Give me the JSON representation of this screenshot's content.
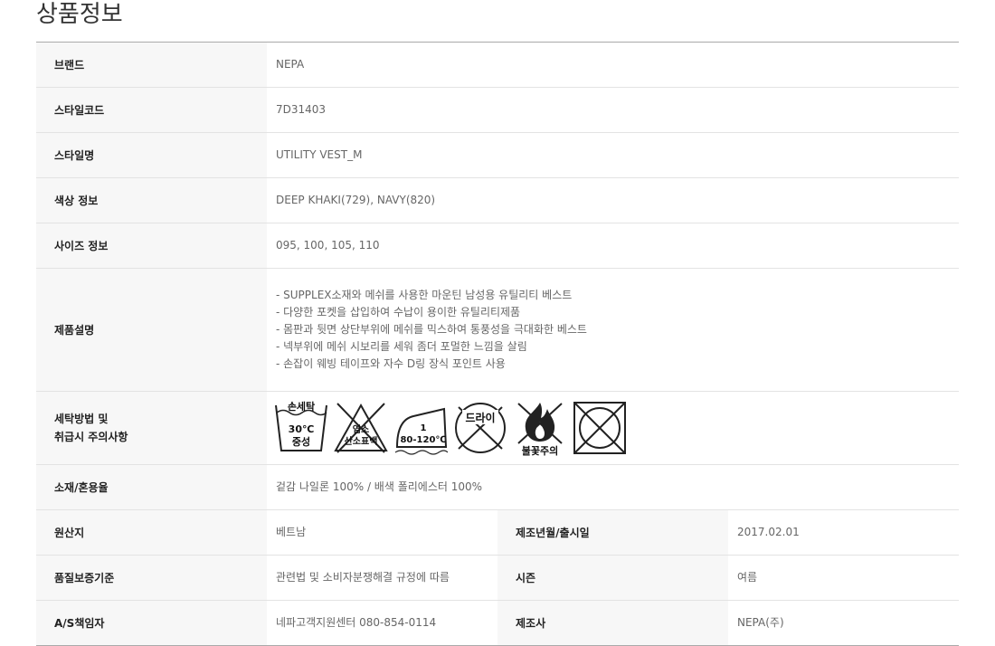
{
  "title": "상품정보",
  "rows": {
    "brand": {
      "label": "브랜드",
      "value": "NEPA"
    },
    "style_code": {
      "label": "스타일코드",
      "value": "7D31403"
    },
    "style_name": {
      "label": "스타일명",
      "value": "UTILITY VEST_M"
    },
    "color": {
      "label": "색상 정보",
      "value": "DEEP KHAKI(729), NAVY(820)"
    },
    "size": {
      "label": "사이즈 정보",
      "value": "095, 100, 105, 110"
    },
    "description": {
      "label": "제품설명",
      "lines": [
        "- SUPPLEX소재와 메쉬를 사용한 마운틴 남성용 유틸리티 베스트",
        "- 다양한 포켓을 삽입하여 수납이 용이한 유틸리티제품",
        "- 몸판과 뒷면 상단부위에 메쉬를 믹스하여 통풍성을 극대화한 베스트",
        "- 넥부위에 메쉬 시보리를 세워 좀더 포멀한 느낌을 살림",
        "- 손잡이 웨빙 테이프와 자수 D링 장식 포인트 사용"
      ]
    },
    "care": {
      "label_line1": "세탁방법 및",
      "label_line2": "취급시 주의사항",
      "icons": {
        "hand_wash": {
          "top": "손세탁",
          "temp": "30℃",
          "bottom": "중성"
        },
        "no_bleach": {
          "line1": "염소",
          "line2": "산소표백"
        },
        "iron": {
          "level": "1",
          "temp": "80-120℃"
        },
        "no_dry_clean": {
          "text": "드라이"
        },
        "fire_caution": {
          "text": "불꽃주의"
        },
        "no_tumble_dry": {}
      }
    },
    "material": {
      "label": "소재/혼용율",
      "value": "겉감 나일론 100% / 배색 폴리에스터 100%"
    },
    "origin": {
      "label": "원산지",
      "value": "베트남",
      "label2": "제조년월/출시일",
      "value2": "2017.02.01"
    },
    "quality": {
      "label": "품질보증기준",
      "value": "관련법 및 소비자분쟁해결 규정에 따름",
      "label2": "시즌",
      "value2": "여름"
    },
    "as": {
      "label": "A/S책임자",
      "value": "네파고객지원센터 080-854-0114",
      "label2": "제조사",
      "value2": "NEPA(주)"
    }
  }
}
